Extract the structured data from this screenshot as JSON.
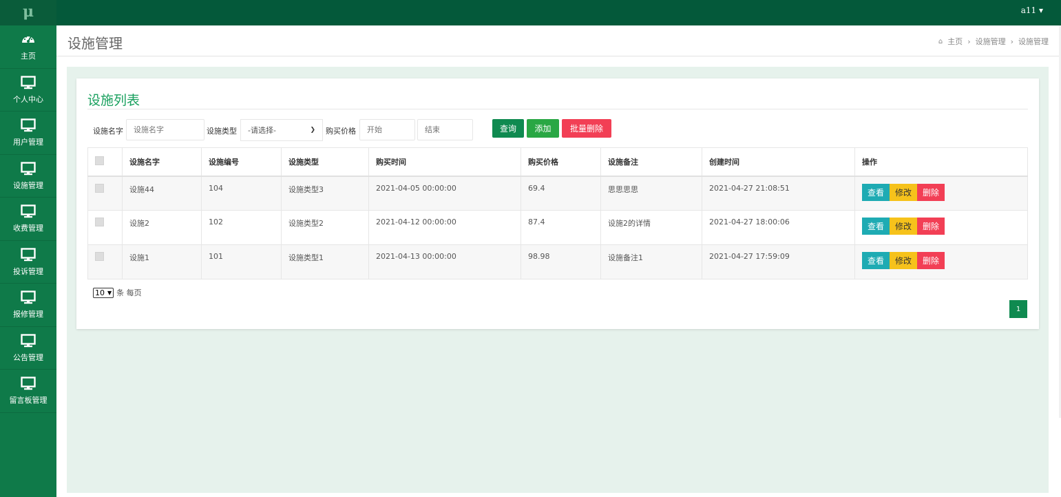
{
  "app": {
    "logo": "μ",
    "user": "a11 ▾"
  },
  "colors": {
    "sidebar": "#0f7a49",
    "topbar": "#04593a",
    "accent": "#19a05e",
    "view": "#1eabb3",
    "edit": "#f6c21b",
    "delete": "#f23f55",
    "search": "#0f8a50",
    "add": "#29a744",
    "batch_delete": "#f23f55",
    "content_bg": "#e6f2ec"
  },
  "sidebar": {
    "items": [
      {
        "label": "主页",
        "icon": "dashboard-icon"
      },
      {
        "label": "个人中心",
        "icon": "monitor-icon"
      },
      {
        "label": "用户管理",
        "icon": "monitor-icon"
      },
      {
        "label": "设施管理",
        "icon": "monitor-icon"
      },
      {
        "label": "收费管理",
        "icon": "monitor-icon"
      },
      {
        "label": "投诉管理",
        "icon": "monitor-icon"
      },
      {
        "label": "报修管理",
        "icon": "monitor-icon"
      },
      {
        "label": "公告管理",
        "icon": "monitor-icon"
      },
      {
        "label": "留言板管理",
        "icon": "monitor-icon"
      }
    ]
  },
  "header": {
    "title": "设施管理",
    "breadcrumb": [
      "主页",
      "设施管理",
      "设施管理"
    ],
    "breadcrumb_sep": "›"
  },
  "panel": {
    "title": "设施列表",
    "search": {
      "name_label": "设施名字",
      "name_placeholder": "设施名字",
      "type_label": "设施类型",
      "type_selected": "-请选择-",
      "price_label": "购买价格",
      "price_start_placeholder": "开始",
      "price_end_placeholder": "结束"
    },
    "buttons": {
      "search": "查询",
      "add": "添加",
      "batch_delete": "批量删除"
    }
  },
  "table": {
    "columns": [
      "设施名字",
      "设施编号",
      "设施类型",
      "购买时间",
      "购买价格",
      "设施备注",
      "创建时间",
      "操作"
    ],
    "rows": [
      [
        "设施44",
        "104",
        "设施类型3",
        "2021-04-05 00:00:00",
        "69.4",
        "思思思思",
        "2021-04-27 21:08:51"
      ],
      [
        "设施2",
        "102",
        "设施类型2",
        "2021-04-12 00:00:00",
        "87.4",
        "设施2的详情",
        "2021-04-27 18:00:06"
      ],
      [
        "设施1",
        "101",
        "设施类型1",
        "2021-04-13 00:00:00",
        "98.98",
        "设施备注1",
        "2021-04-27 17:59:09"
      ]
    ],
    "row_actions": {
      "view": "查看",
      "edit": "修改",
      "delete": "删除"
    }
  },
  "pagination": {
    "page_size": "10",
    "page_size_suffix": "条 每页",
    "current_page": "1"
  }
}
